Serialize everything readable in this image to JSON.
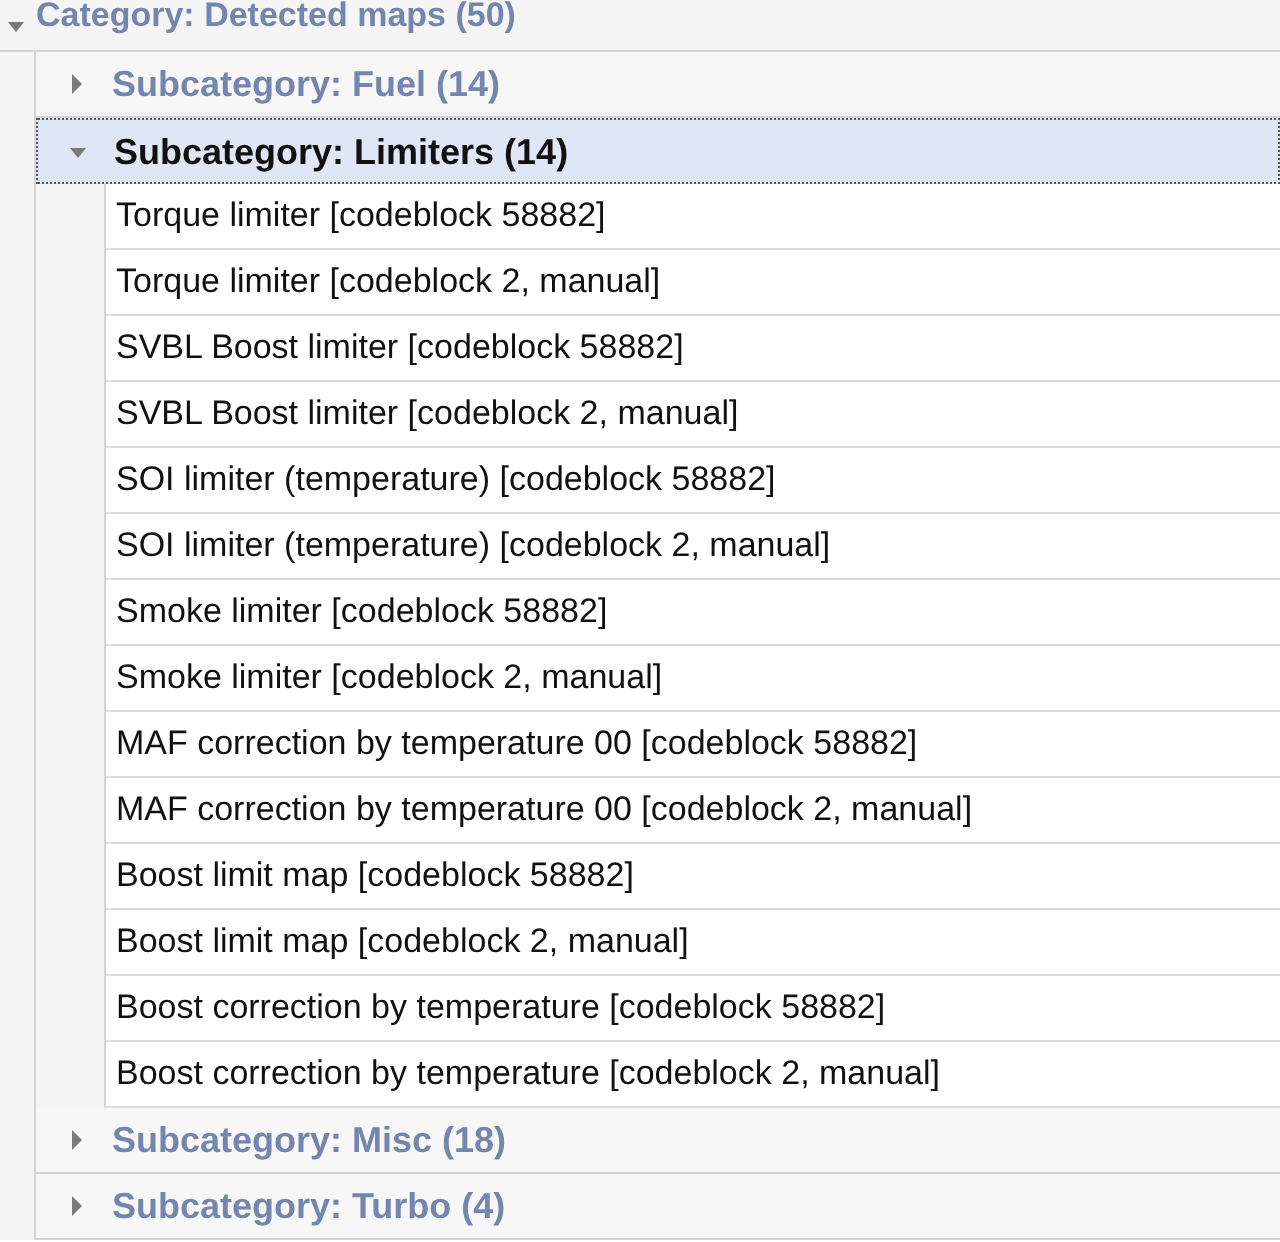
{
  "category": {
    "label": "Category: Detected maps (50)",
    "expanded": true,
    "subcategories": [
      {
        "label": "Subcategory: Fuel (14)",
        "expanded": false,
        "selected": false
      },
      {
        "label": "Subcategory: Limiters (14)",
        "expanded": true,
        "selected": true,
        "children": [
          {
            "label": "Torque limiter [codeblock 58882]"
          },
          {
            "label": "Torque limiter [codeblock 2, manual]"
          },
          {
            "label": "SVBL Boost limiter [codeblock 58882]"
          },
          {
            "label": "SVBL Boost limiter [codeblock 2, manual]"
          },
          {
            "label": "SOI limiter (temperature) [codeblock 58882]"
          },
          {
            "label": "SOI limiter (temperature) [codeblock 2, manual]"
          },
          {
            "label": "Smoke limiter [codeblock 58882]"
          },
          {
            "label": "Smoke limiter [codeblock 2, manual]"
          },
          {
            "label": "MAF correction by temperature 00 [codeblock 58882]"
          },
          {
            "label": "MAF correction by temperature 00 [codeblock 2, manual]"
          },
          {
            "label": "Boost limit map [codeblock 58882]"
          },
          {
            "label": "Boost limit map [codeblock 2, manual]"
          },
          {
            "label": "Boost correction by temperature [codeblock 58882]"
          },
          {
            "label": "Boost correction by temperature [codeblock 2, manual]"
          }
        ]
      },
      {
        "label": "Subcategory: Misc (18)",
        "expanded": false,
        "selected": false
      },
      {
        "label": "Subcategory: Turbo (4)",
        "expanded": false,
        "selected": false
      }
    ]
  }
}
